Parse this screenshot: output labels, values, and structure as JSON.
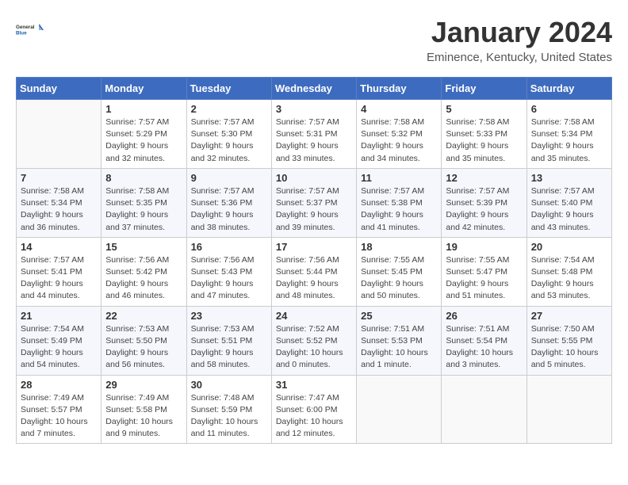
{
  "logo": {
    "line1": "General",
    "line2": "Blue"
  },
  "title": "January 2024",
  "subtitle": "Eminence, Kentucky, United States",
  "weekdays": [
    "Sunday",
    "Monday",
    "Tuesday",
    "Wednesday",
    "Thursday",
    "Friday",
    "Saturday"
  ],
  "weeks": [
    [
      {
        "day": "",
        "info": ""
      },
      {
        "day": "1",
        "info": "Sunrise: 7:57 AM\nSunset: 5:29 PM\nDaylight: 9 hours\nand 32 minutes."
      },
      {
        "day": "2",
        "info": "Sunrise: 7:57 AM\nSunset: 5:30 PM\nDaylight: 9 hours\nand 32 minutes."
      },
      {
        "day": "3",
        "info": "Sunrise: 7:57 AM\nSunset: 5:31 PM\nDaylight: 9 hours\nand 33 minutes."
      },
      {
        "day": "4",
        "info": "Sunrise: 7:58 AM\nSunset: 5:32 PM\nDaylight: 9 hours\nand 34 minutes."
      },
      {
        "day": "5",
        "info": "Sunrise: 7:58 AM\nSunset: 5:33 PM\nDaylight: 9 hours\nand 35 minutes."
      },
      {
        "day": "6",
        "info": "Sunrise: 7:58 AM\nSunset: 5:34 PM\nDaylight: 9 hours\nand 35 minutes."
      }
    ],
    [
      {
        "day": "7",
        "info": "Sunrise: 7:58 AM\nSunset: 5:34 PM\nDaylight: 9 hours\nand 36 minutes."
      },
      {
        "day": "8",
        "info": "Sunrise: 7:58 AM\nSunset: 5:35 PM\nDaylight: 9 hours\nand 37 minutes."
      },
      {
        "day": "9",
        "info": "Sunrise: 7:57 AM\nSunset: 5:36 PM\nDaylight: 9 hours\nand 38 minutes."
      },
      {
        "day": "10",
        "info": "Sunrise: 7:57 AM\nSunset: 5:37 PM\nDaylight: 9 hours\nand 39 minutes."
      },
      {
        "day": "11",
        "info": "Sunrise: 7:57 AM\nSunset: 5:38 PM\nDaylight: 9 hours\nand 41 minutes."
      },
      {
        "day": "12",
        "info": "Sunrise: 7:57 AM\nSunset: 5:39 PM\nDaylight: 9 hours\nand 42 minutes."
      },
      {
        "day": "13",
        "info": "Sunrise: 7:57 AM\nSunset: 5:40 PM\nDaylight: 9 hours\nand 43 minutes."
      }
    ],
    [
      {
        "day": "14",
        "info": "Sunrise: 7:57 AM\nSunset: 5:41 PM\nDaylight: 9 hours\nand 44 minutes."
      },
      {
        "day": "15",
        "info": "Sunrise: 7:56 AM\nSunset: 5:42 PM\nDaylight: 9 hours\nand 46 minutes."
      },
      {
        "day": "16",
        "info": "Sunrise: 7:56 AM\nSunset: 5:43 PM\nDaylight: 9 hours\nand 47 minutes."
      },
      {
        "day": "17",
        "info": "Sunrise: 7:56 AM\nSunset: 5:44 PM\nDaylight: 9 hours\nand 48 minutes."
      },
      {
        "day": "18",
        "info": "Sunrise: 7:55 AM\nSunset: 5:45 PM\nDaylight: 9 hours\nand 50 minutes."
      },
      {
        "day": "19",
        "info": "Sunrise: 7:55 AM\nSunset: 5:47 PM\nDaylight: 9 hours\nand 51 minutes."
      },
      {
        "day": "20",
        "info": "Sunrise: 7:54 AM\nSunset: 5:48 PM\nDaylight: 9 hours\nand 53 minutes."
      }
    ],
    [
      {
        "day": "21",
        "info": "Sunrise: 7:54 AM\nSunset: 5:49 PM\nDaylight: 9 hours\nand 54 minutes."
      },
      {
        "day": "22",
        "info": "Sunrise: 7:53 AM\nSunset: 5:50 PM\nDaylight: 9 hours\nand 56 minutes."
      },
      {
        "day": "23",
        "info": "Sunrise: 7:53 AM\nSunset: 5:51 PM\nDaylight: 9 hours\nand 58 minutes."
      },
      {
        "day": "24",
        "info": "Sunrise: 7:52 AM\nSunset: 5:52 PM\nDaylight: 10 hours\nand 0 minutes."
      },
      {
        "day": "25",
        "info": "Sunrise: 7:51 AM\nSunset: 5:53 PM\nDaylight: 10 hours\nand 1 minute."
      },
      {
        "day": "26",
        "info": "Sunrise: 7:51 AM\nSunset: 5:54 PM\nDaylight: 10 hours\nand 3 minutes."
      },
      {
        "day": "27",
        "info": "Sunrise: 7:50 AM\nSunset: 5:55 PM\nDaylight: 10 hours\nand 5 minutes."
      }
    ],
    [
      {
        "day": "28",
        "info": "Sunrise: 7:49 AM\nSunset: 5:57 PM\nDaylight: 10 hours\nand 7 minutes."
      },
      {
        "day": "29",
        "info": "Sunrise: 7:49 AM\nSunset: 5:58 PM\nDaylight: 10 hours\nand 9 minutes."
      },
      {
        "day": "30",
        "info": "Sunrise: 7:48 AM\nSunset: 5:59 PM\nDaylight: 10 hours\nand 11 minutes."
      },
      {
        "day": "31",
        "info": "Sunrise: 7:47 AM\nSunset: 6:00 PM\nDaylight: 10 hours\nand 12 minutes."
      },
      {
        "day": "",
        "info": ""
      },
      {
        "day": "",
        "info": ""
      },
      {
        "day": "",
        "info": ""
      }
    ]
  ]
}
